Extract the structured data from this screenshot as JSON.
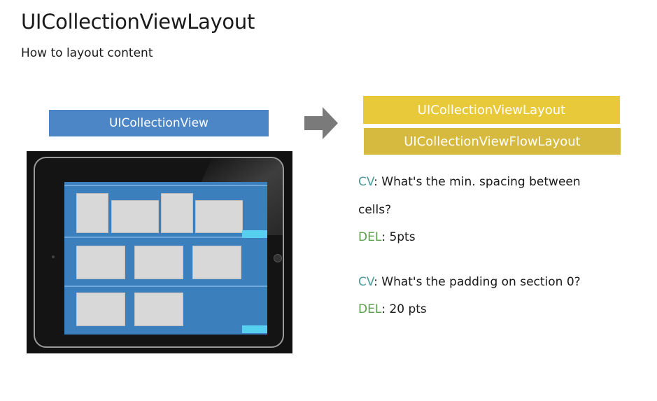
{
  "slide": {
    "title": "UICollectionViewLayout",
    "subtitle": "How to layout content"
  },
  "left": {
    "collection_view_label": "UICollectionView"
  },
  "right": {
    "layout_label": "UICollectionViewLayout",
    "flow_layout_label": "UICollectionViewFlowLayout"
  },
  "dialog": {
    "q1_speaker": "CV",
    "q1_text_line1": ": What's the min. spacing between",
    "q1_text_line2": "cells?",
    "a1_speaker": "DEL",
    "a1_text": ": 5pts",
    "q2_speaker": "CV",
    "q2_text": ": What's the padding on section 0?",
    "a2_speaker": "DEL",
    "a2_text": ": 20 pts"
  },
  "colors": {
    "collection_view_bar": "#4d86c6",
    "layout_bar": "#e8c93a",
    "flow_layout_bar": "#d6b93f",
    "cv_speaker": "#4a9a9a",
    "del_speaker": "#5aa04a",
    "screen_blue": "#3c7fbd",
    "highlight_cyan": "#56d0ee"
  },
  "icons": {
    "arrow": "right-arrow-icon"
  }
}
